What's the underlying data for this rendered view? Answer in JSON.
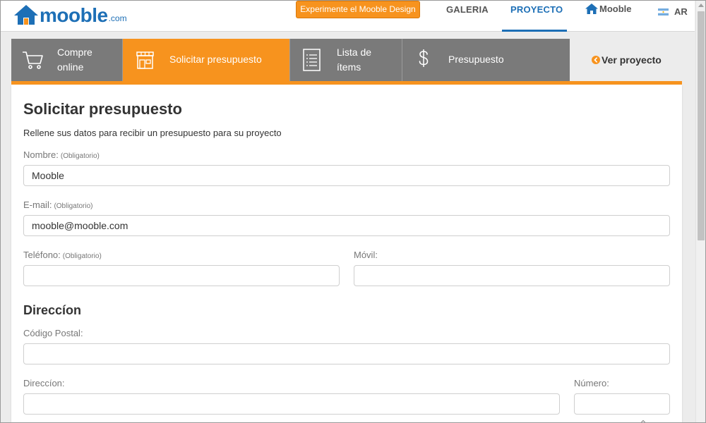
{
  "header": {
    "logo_word": "mooble",
    "logo_tld": ".com",
    "cta_label": "Experimente el Mooble Design",
    "nav": {
      "galeria": "GALERIA",
      "proyecto": "PROYECTO",
      "mooble": "Mooble",
      "lang": "AR"
    },
    "active_nav": "PROYECTO"
  },
  "steps": [
    {
      "icon": "shopping-cart-icon",
      "label_line1": "Compre",
      "label_line2": "online",
      "active": false
    },
    {
      "icon": "storefront-icon",
      "label": "Solicitar presupuesto",
      "active": true
    },
    {
      "icon": "list-document-icon",
      "label_line1": "Lista de",
      "label_line2": "ítems",
      "active": false
    },
    {
      "icon": "dollar-icon",
      "label": "Presupuesto",
      "active": false
    }
  ],
  "ver_proyecto": "Ver proyecto",
  "form": {
    "title": "Solicitar presupuesto",
    "subtitle": "Rellene sus datos para recibir un presupuesto para su proyecto",
    "required_tag": "(Obligatorio)",
    "nombre": {
      "label": "Nombre:",
      "value": "Mooble"
    },
    "email": {
      "label": "E-mail:",
      "value": "mooble@mooble.com"
    },
    "telefono": {
      "label": "Teléfono:",
      "value": ""
    },
    "movil": {
      "label": "Móvil:",
      "value": ""
    },
    "direccion_heading": "Direccíon",
    "codigo_postal": {
      "label": "Código Postal:",
      "value": ""
    },
    "direccion": {
      "label": "Direccíon:",
      "value": ""
    },
    "numero": {
      "label": "Número:",
      "value": ""
    }
  },
  "colors": {
    "brand_blue": "#1d6fb6",
    "accent_orange": "#f7931e",
    "step_gray": "#7a7a7a"
  }
}
